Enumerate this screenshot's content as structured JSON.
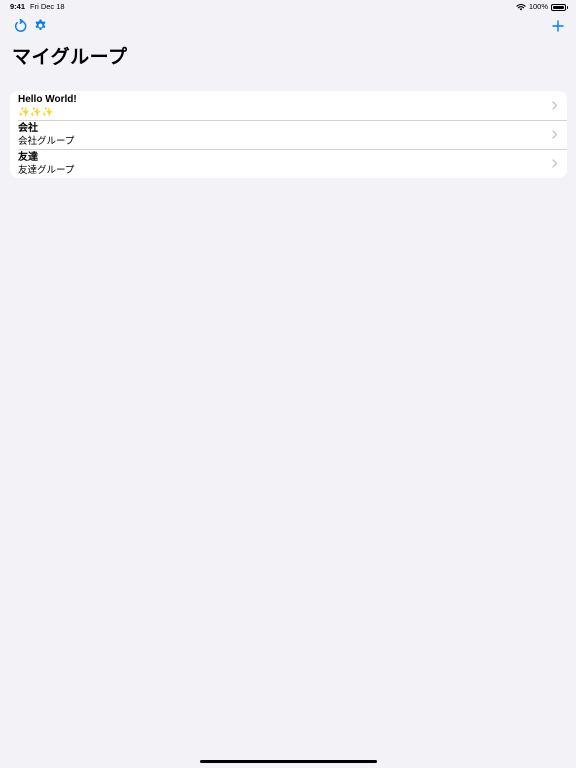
{
  "status_bar": {
    "time": "9:41",
    "date": "Fri Dec 18",
    "battery": "100%"
  },
  "nav": {
    "title": "マイグループ",
    "left_icons": [
      "refresh-icon",
      "gear-icon"
    ],
    "right_icons": [
      "plus-icon"
    ]
  },
  "groups": [
    {
      "title": "Hello World!",
      "subtitle": "✨✨✨"
    },
    {
      "title": "会社",
      "subtitle": "会社グループ"
    },
    {
      "title": "友達",
      "subtitle": "友達グループ"
    }
  ],
  "colors": {
    "accent": "#007aff",
    "background": "#f2f2f7",
    "card": "#ffffff",
    "chevron": "#c4c4c7",
    "separator": "#d1d1d6"
  }
}
